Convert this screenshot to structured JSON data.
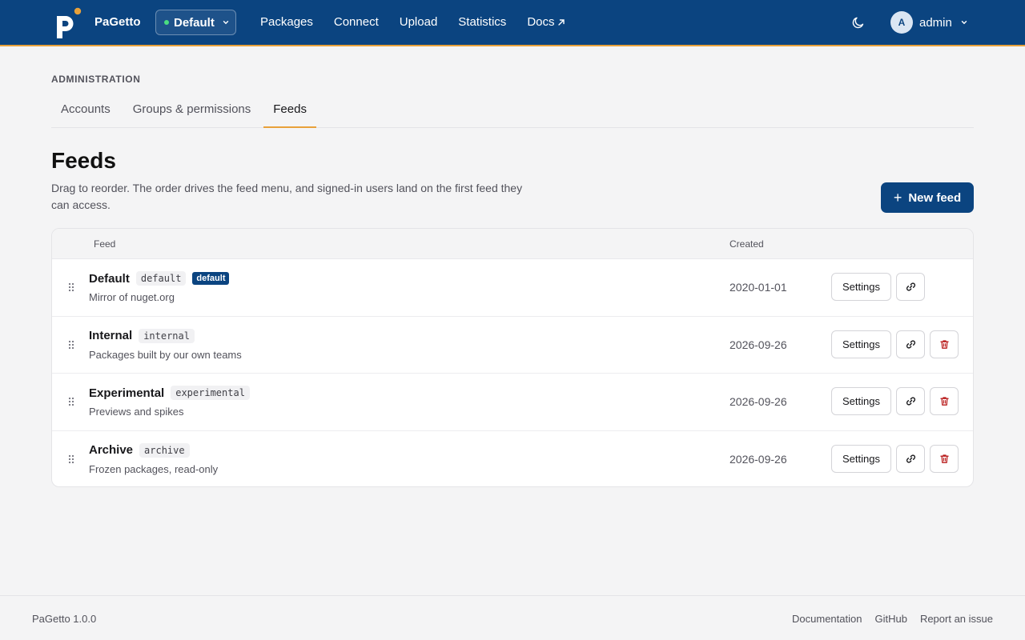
{
  "app": {
    "brand": "PaGetto",
    "current_feed": "Default"
  },
  "nav": {
    "links": [
      "Packages",
      "Connect",
      "Upload",
      "Statistics",
      "Docs"
    ],
    "user": {
      "initial": "A",
      "name": "admin"
    }
  },
  "admin": {
    "section_label": "ADMINISTRATION",
    "tabs": [
      {
        "label": "Accounts",
        "active": false
      },
      {
        "label": "Groups & permissions",
        "active": false
      },
      {
        "label": "Feeds",
        "active": true
      }
    ]
  },
  "page": {
    "title": "Feeds",
    "description": "Drag to reorder. The order drives the feed menu, and signed-in users land on the first feed they can access.",
    "new_button": "New feed"
  },
  "table": {
    "columns": {
      "feed": "Feed",
      "created": "Created"
    },
    "settings_label": "Settings",
    "rows": [
      {
        "name": "Default",
        "slug": "default",
        "badge": "default",
        "description": "Mirror of nuget.org",
        "created": "2020-01-01",
        "deletable": false
      },
      {
        "name": "Internal",
        "slug": "internal",
        "badge": "",
        "description": "Packages built by our own teams",
        "created": "2026-09-26",
        "deletable": true
      },
      {
        "name": "Experimental",
        "slug": "experimental",
        "badge": "",
        "description": "Previews and spikes",
        "created": "2026-09-26",
        "deletable": true
      },
      {
        "name": "Archive",
        "slug": "archive",
        "badge": "",
        "description": "Frozen packages, read-only",
        "created": "2026-09-26",
        "deletable": true
      }
    ]
  },
  "footer": {
    "version": "PaGetto 1.0.0",
    "links": [
      "Documentation",
      "GitHub",
      "Report an issue"
    ]
  },
  "colors": {
    "primary": "#0b4480",
    "accent": "#e8a13a",
    "status_green": "#4ade80",
    "danger": "#b91c1c"
  }
}
